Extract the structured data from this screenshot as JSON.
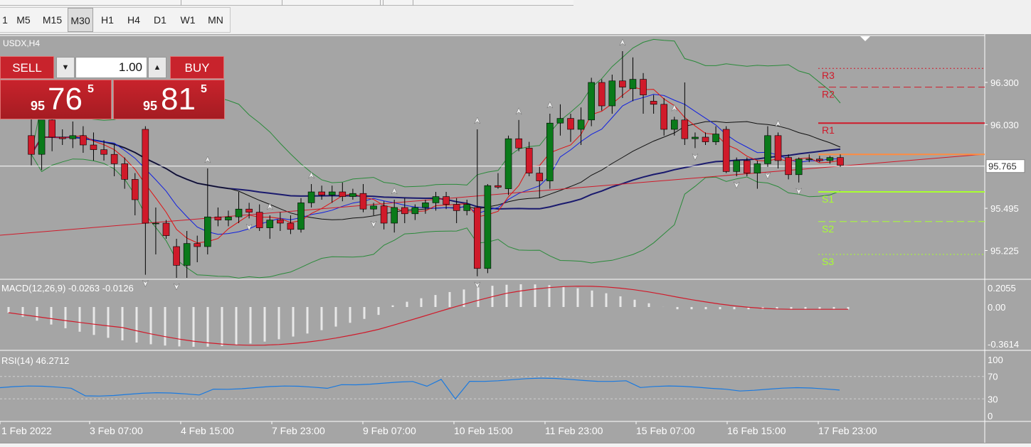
{
  "toolbar": {
    "timeframes": [
      "1",
      "M5",
      "M15",
      "M30",
      "H1",
      "H4",
      "D1",
      "W1",
      "MN"
    ],
    "active": "M30"
  },
  "chart": {
    "symbol_label": "USDX,H4",
    "current_price": "95.765",
    "price_ticks": [
      "96.300",
      "96.030",
      "95.495",
      "95.225"
    ],
    "pivot_labels": {
      "R3": "R3",
      "R2": "R2",
      "R1": "R1",
      "S1": "S1",
      "S2": "S2",
      "S3": "S3"
    },
    "time_labels": [
      "1 Feb 2022",
      "3 Feb 07:00",
      "4 Feb 15:00",
      "7 Feb 23:00",
      "9 Feb 07:00",
      "10 Feb 15:00",
      "11 Feb 23:00",
      "15 Feb 07:00",
      "16 Feb 15:00",
      "17 Feb 23:00"
    ],
    "colors": {
      "background": "#a5a5a5",
      "bull": "#0a7a1a",
      "bear": "#d01a2a",
      "ma_fast": "#e01010",
      "ma_mid": "#1020e0",
      "ma_slow": "#101010",
      "ma_long": "#1a1a6e",
      "bands": "#2a8a3a",
      "resistance": "#d01a2a",
      "support": "#a8ff30"
    }
  },
  "trade_panel": {
    "sell_label": "SELL",
    "buy_label": "BUY",
    "lot_value": "1.00",
    "sell_price": {
      "prefix": "95",
      "big": "76",
      "sup": "5"
    },
    "buy_price": {
      "prefix": "95",
      "big": "81",
      "sup": "5"
    },
    "down_icon": "triangle-down",
    "up_icon": "triangle-up"
  },
  "macd": {
    "caption": "MACD(12,26,9) -0.0263 -0.0126",
    "ticks": [
      "0.2055",
      "0.00",
      "-0.3614"
    ]
  },
  "rsi": {
    "caption": "RSI(14) 46.2712",
    "ticks": [
      "100",
      "70",
      "30",
      "0"
    ]
  },
  "chart_data": {
    "type": "candlestick",
    "symbol": "USDX,H4",
    "y_unit": "price",
    "ylim": [
      95.05,
      96.6
    ],
    "x_labels": [
      "1 Feb 2022",
      "3 Feb 07:00",
      "4 Feb 15:00",
      "7 Feb 23:00",
      "9 Feb 07:00",
      "10 Feb 15:00",
      "11 Feb 23:00",
      "15 Feb 07:00",
      "16 Feb 15:00",
      "17 Feb 23:00"
    ],
    "candles": [
      [
        95.96,
        96.11,
        95.77,
        95.84
      ],
      [
        95.84,
        95.92,
        95.74,
        96.06
      ],
      [
        96.06,
        96.12,
        95.86,
        95.95
      ],
      [
        95.95,
        96.0,
        95.9,
        95.94
      ],
      [
        95.94,
        96.05,
        95.88,
        95.96
      ],
      [
        95.96,
        96.02,
        95.85,
        95.9
      ],
      [
        95.9,
        95.98,
        95.8,
        95.87
      ],
      [
        95.87,
        95.93,
        95.8,
        95.84
      ],
      [
        95.84,
        95.9,
        95.7,
        95.78
      ],
      [
        95.78,
        95.82,
        95.62,
        95.68
      ],
      [
        95.68,
        95.72,
        95.45,
        95.55
      ],
      [
        96.0,
        96.02,
        95.07,
        95.4
      ],
      [
        95.4,
        95.5,
        95.2,
        95.4
      ],
      [
        95.4,
        95.42,
        95.3,
        95.32
      ],
      [
        95.25,
        95.3,
        95.05,
        95.13
      ],
      [
        95.13,
        95.35,
        95.05,
        95.27
      ],
      [
        95.27,
        95.32,
        95.15,
        95.25
      ],
      [
        95.25,
        95.75,
        95.2,
        95.44
      ],
      [
        95.44,
        95.5,
        95.38,
        95.42
      ],
      [
        95.42,
        95.48,
        95.38,
        95.44
      ],
      [
        95.44,
        95.6,
        95.4,
        95.49
      ],
      [
        95.49,
        95.53,
        95.43,
        95.47
      ],
      [
        95.47,
        95.52,
        95.35,
        95.37
      ],
      [
        95.37,
        95.45,
        95.3,
        95.42
      ],
      [
        95.42,
        95.47,
        95.35,
        95.4
      ],
      [
        95.4,
        95.45,
        95.33,
        95.36
      ],
      [
        95.36,
        95.56,
        95.34,
        95.53
      ],
      [
        95.53,
        95.65,
        95.5,
        95.6
      ],
      [
        95.6,
        95.64,
        95.55,
        95.58
      ],
      [
        95.58,
        95.64,
        95.53,
        95.6
      ],
      [
        95.6,
        95.66,
        95.54,
        95.57
      ],
      [
        95.57,
        95.62,
        95.55,
        95.59
      ],
      [
        95.59,
        95.65,
        95.47,
        95.49
      ],
      [
        95.49,
        95.53,
        95.45,
        95.51
      ],
      [
        95.51,
        95.54,
        95.36,
        95.4
      ],
      [
        95.4,
        95.55,
        95.34,
        95.5
      ],
      [
        95.5,
        95.56,
        95.4,
        95.46
      ],
      [
        95.46,
        95.52,
        95.42,
        95.5
      ],
      [
        95.5,
        95.55,
        95.46,
        95.53
      ],
      [
        95.53,
        95.6,
        95.48,
        95.57
      ],
      [
        95.57,
        95.6,
        95.49,
        95.52
      ],
      [
        95.52,
        95.56,
        95.4,
        95.48
      ],
      [
        95.48,
        95.55,
        95.45,
        95.52
      ],
      [
        95.5,
        96.0,
        95.06,
        95.11
      ],
      [
        95.11,
        95.65,
        95.08,
        95.64
      ],
      [
        95.64,
        95.72,
        95.62,
        95.63
      ],
      [
        95.62,
        95.96,
        95.58,
        95.94
      ],
      [
        95.94,
        96.06,
        95.86,
        95.88
      ],
      [
        95.88,
        95.92,
        95.7,
        95.72
      ],
      [
        95.72,
        95.76,
        95.56,
        95.67
      ],
      [
        95.67,
        96.1,
        95.62,
        96.04
      ],
      [
        96.04,
        96.16,
        95.96,
        96.07
      ],
      [
        96.07,
        96.1,
        95.92,
        96.0
      ],
      [
        96.0,
        96.14,
        95.9,
        96.06
      ],
      [
        96.06,
        96.33,
        96.02,
        96.3
      ],
      [
        96.3,
        96.32,
        96.12,
        96.15
      ],
      [
        96.15,
        96.35,
        96.1,
        96.31
      ],
      [
        96.31,
        96.5,
        96.2,
        96.27
      ],
      [
        96.26,
        96.46,
        96.18,
        96.32
      ],
      [
        96.32,
        96.36,
        96.1,
        96.22
      ],
      [
        96.18,
        96.22,
        96.1,
        96.16
      ],
      [
        96.16,
        96.2,
        95.96,
        96.0
      ],
      [
        96.0,
        96.08,
        95.96,
        96.06
      ],
      [
        96.06,
        96.3,
        95.9,
        95.94
      ],
      [
        95.94,
        95.98,
        95.88,
        95.95
      ],
      [
        95.95,
        95.98,
        95.9,
        95.92
      ],
      [
        95.92,
        96.02,
        95.9,
        95.97
      ],
      [
        96.0,
        96.02,
        95.72,
        95.73
      ],
      [
        95.73,
        95.82,
        95.7,
        95.8
      ],
      [
        95.8,
        95.82,
        95.7,
        95.72
      ],
      [
        95.72,
        95.8,
        95.62,
        95.78
      ],
      [
        95.78,
        96.02,
        95.76,
        95.96
      ],
      [
        95.96,
        95.98,
        95.75,
        95.8
      ],
      [
        95.82,
        95.84,
        95.68,
        95.71
      ],
      [
        95.71,
        95.82,
        95.66,
        95.81
      ],
      [
        95.81,
        95.84,
        95.79,
        95.81
      ],
      [
        95.81,
        95.83,
        95.79,
        95.8
      ],
      [
        95.8,
        95.83,
        95.78,
        95.82
      ],
      [
        95.82,
        95.84,
        95.76,
        95.77
      ]
    ],
    "pivot_levels": {
      "R3": 96.39,
      "R2": 96.27,
      "R1": 96.04,
      "S1": 95.6,
      "S2": 95.41,
      "S3": 95.2
    },
    "current_price": 95.765,
    "macd": {
      "params": "12,26,9",
      "main": -0.0263,
      "signal": -0.0126,
      "ylim": [
        -0.3614,
        0.2055
      ]
    },
    "rsi": {
      "period": 14,
      "value": 46.2712,
      "levels": [
        70,
        30
      ],
      "ylim": [
        0,
        100
      ]
    }
  }
}
